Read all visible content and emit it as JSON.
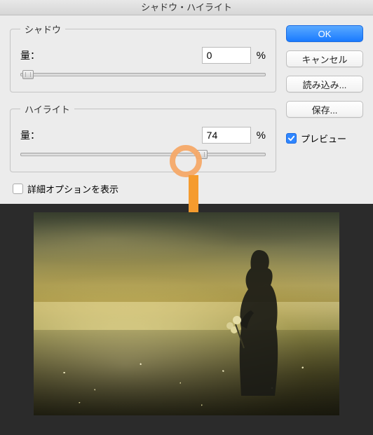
{
  "dialog": {
    "title": "シャドウ・ハイライト"
  },
  "shadow": {
    "legend": "シャドウ",
    "amount_label": "量：",
    "value": "0",
    "unit": "%",
    "slider_pct": 3
  },
  "highlight": {
    "legend": "ハイライト",
    "amount_label": "量：",
    "value": "74",
    "unit": "%",
    "slider_pct": 74
  },
  "options": {
    "show_more_label": "詳細オプションを表示",
    "checked": false
  },
  "buttons": {
    "ok": "OK",
    "cancel": "キャンセル",
    "load": "読み込み...",
    "save": "保存..."
  },
  "preview": {
    "label": "プレビュー",
    "checked": true
  }
}
